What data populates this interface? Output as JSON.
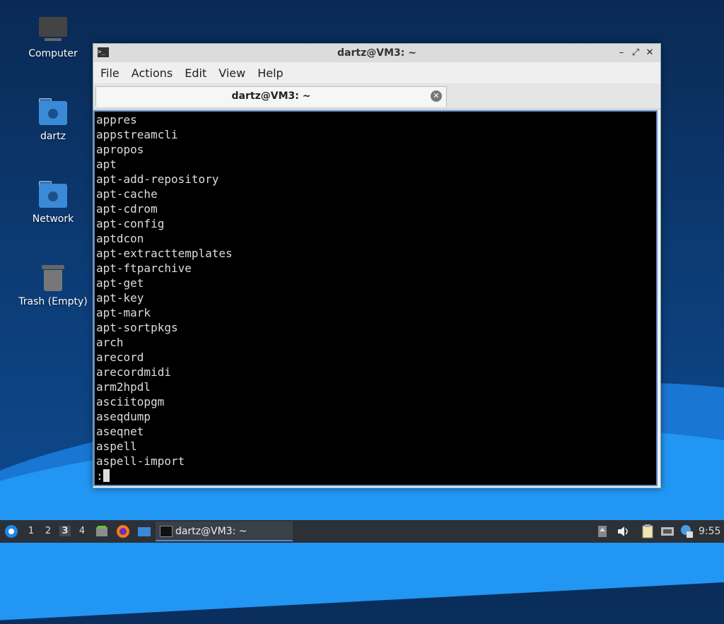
{
  "desktop": {
    "icons": [
      {
        "label": "Computer",
        "icon": "computer-icon"
      },
      {
        "label": "dartz",
        "icon": "home-folder-icon"
      },
      {
        "label": "Network",
        "icon": "network-folder-icon"
      },
      {
        "label": "Trash (Empty)",
        "icon": "trash-icon"
      }
    ]
  },
  "window": {
    "title": "dartz@VM3: ~",
    "controls": {
      "minimize": "–",
      "maximize": "⤢",
      "close": "✕"
    },
    "menu": [
      "File",
      "Actions",
      "Edit",
      "View",
      "Help"
    ],
    "tab": {
      "title": "dartz@VM3: ~",
      "close": "✕"
    },
    "terminal": {
      "lines": [
        "appres",
        "appstreamcli",
        "apropos",
        "apt",
        "apt-add-repository",
        "apt-cache",
        "apt-cdrom",
        "apt-config",
        "aptdcon",
        "apt-extracttemplates",
        "apt-ftparchive",
        "apt-get",
        "apt-key",
        "apt-mark",
        "apt-sortpkgs",
        "arch",
        "arecord",
        "arecordmidi",
        "arm2hpdl",
        "asciitopgm",
        "aseqdump",
        "aseqnet",
        "aspell",
        "aspell-import"
      ],
      "prompt": ":"
    }
  },
  "taskbar": {
    "start_icon": "lubuntu-start-icon",
    "workspaces": [
      "1",
      "2",
      "3",
      "4"
    ],
    "active_workspace": "3",
    "launchers": [
      "file-manager-icon",
      "firefox-icon",
      "show-desktop-icon"
    ],
    "task": {
      "title": "dartz@VM3: ~"
    },
    "tray": [
      "eject-icon",
      "volume-icon",
      "clipboard-icon",
      "network-icon",
      "update-icon"
    ],
    "clock": "9:55"
  },
  "colors": {
    "accent": "#5a86c8",
    "terminal_bg": "#000000",
    "taskbar_bg": "#2c3138"
  }
}
